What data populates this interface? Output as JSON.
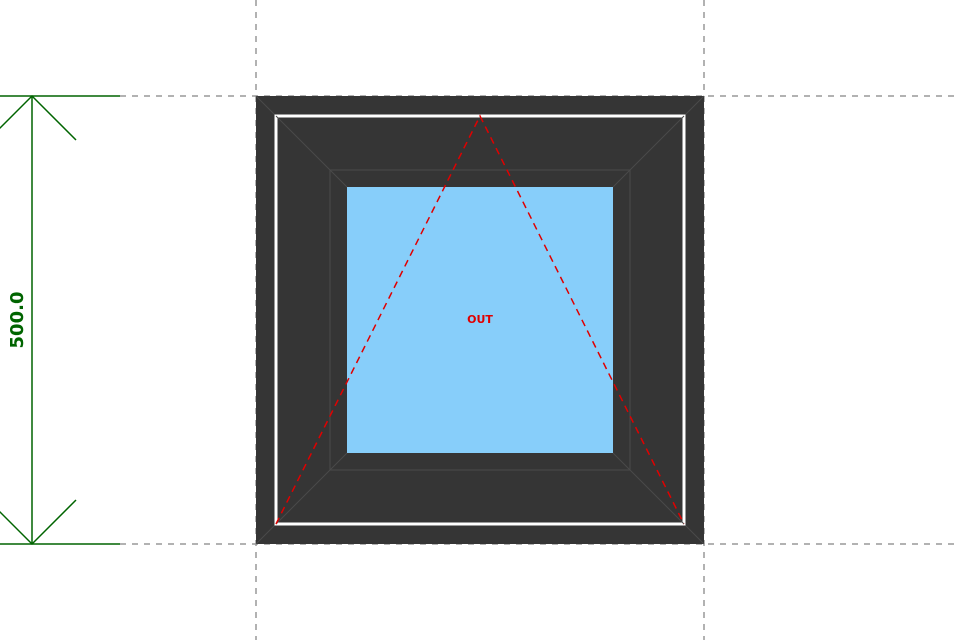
{
  "dimension": {
    "label": "500.0",
    "color": "#006400"
  },
  "window": {
    "opening_label": "OUT",
    "opening_type": "top-hung",
    "colors": {
      "frame": "#353535",
      "frame_edge": "#4a4a4a",
      "sash_border": "#ffffff",
      "glass": "#87CEFA",
      "opening_marker": "#e00000"
    }
  },
  "guides": {
    "color": "#999999"
  }
}
